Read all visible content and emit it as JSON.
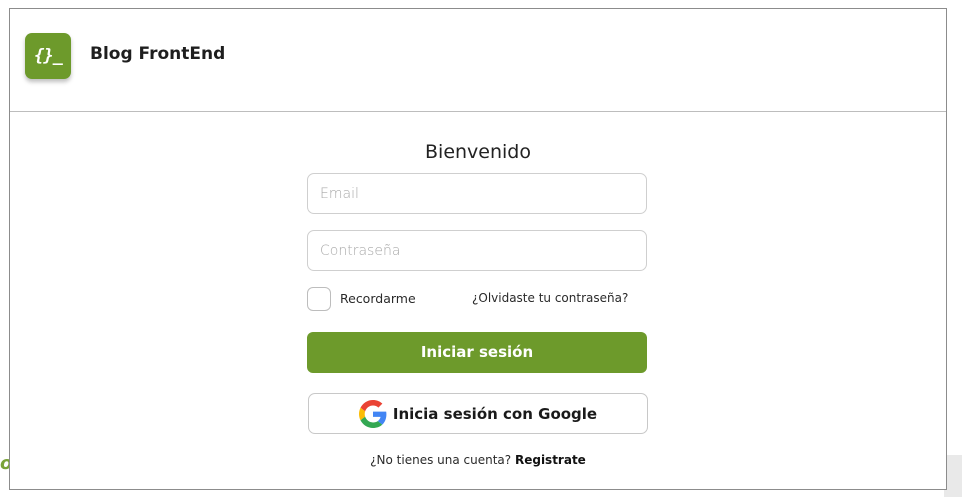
{
  "header": {
    "logo_text": "{}_",
    "brand": "Blog FrontEnd"
  },
  "login": {
    "title": "Bienvenido",
    "email_placeholder": "Email",
    "password_placeholder": "Contraseña",
    "remember_label": "Recordarme",
    "forgot_link": "¿Olvidaste tu contraseña?",
    "submit_label": "Iniciar sesión",
    "google_label": "Inicia sesión con Google",
    "signup_prompt": "¿No tienes una cuenta? ",
    "signup_link": "Registrate"
  },
  "background": {
    "partial_glyph": "o)"
  },
  "colors": {
    "accent": "#6d9a2b",
    "google_blue": "#4285F4",
    "google_red": "#EA4335",
    "google_yellow": "#FBBC05",
    "google_green": "#34A853"
  },
  "icons": {
    "logo": "code-braces-icon",
    "google": "google-icon"
  }
}
